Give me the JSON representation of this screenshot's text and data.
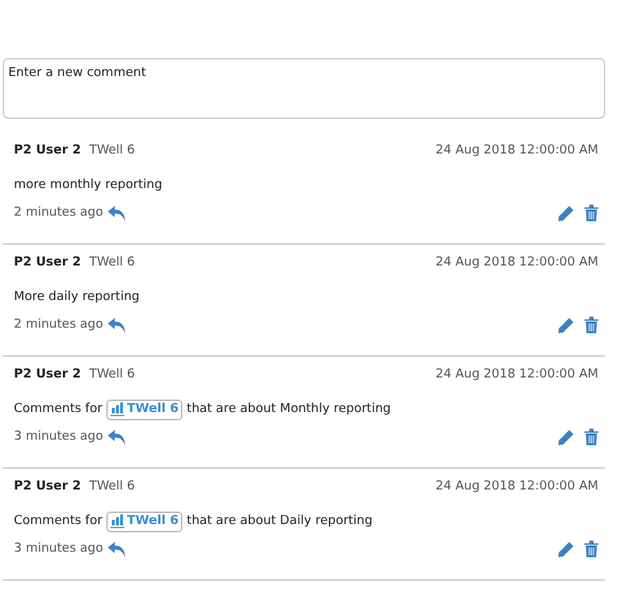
{
  "new_comment": {
    "placeholder": "Enter a new comment"
  },
  "comments": [
    {
      "author": "P2 User 2",
      "context": "TWell 6",
      "date": "24 Aug 2018 12:00:00 AM",
      "body": [
        {
          "kind": "text",
          "text": "more monthly reporting"
        }
      ],
      "age": "2 minutes ago"
    },
    {
      "author": "P2 User 2",
      "context": "TWell 6",
      "date": "24 Aug 2018 12:00:00 AM",
      "body": [
        {
          "kind": "text",
          "text": "More daily reporting"
        }
      ],
      "age": "2 minutes ago"
    },
    {
      "author": "P2 User 2",
      "context": "TWell 6",
      "date": "24 Aug 2018 12:00:00 AM",
      "body": [
        {
          "kind": "text",
          "text": "Comments for "
        },
        {
          "kind": "chip",
          "text": "TWell 6"
        },
        {
          "kind": "text",
          "text": " that are about Monthly reporting"
        }
      ],
      "age": "3 minutes ago"
    },
    {
      "author": "P2 User 2",
      "context": "TWell 6",
      "date": "24 Aug 2018 12:00:00 AM",
      "body": [
        {
          "kind": "text",
          "text": "Comments for "
        },
        {
          "kind": "chip",
          "text": "TWell 6"
        },
        {
          "kind": "text",
          "text": " that are about Daily reporting"
        }
      ],
      "age": "3 minutes ago"
    }
  ]
}
